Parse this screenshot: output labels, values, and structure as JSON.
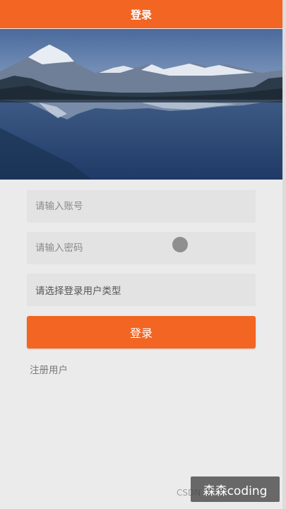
{
  "header": {
    "title": "登录"
  },
  "banner": {
    "image": "mountain-lake-landscape"
  },
  "form": {
    "account_placeholder": "请输入账号",
    "password_placeholder": "请输入密码",
    "user_type_placeholder": "请选择登录用户类型",
    "login_label": "登录",
    "register_label": "注册用户"
  },
  "watermark": {
    "csdn": "CSDN",
    "author": "森森coding"
  },
  "colors": {
    "accent": "#f26522",
    "background": "#ebebeb",
    "field": "#e3e3e3"
  }
}
